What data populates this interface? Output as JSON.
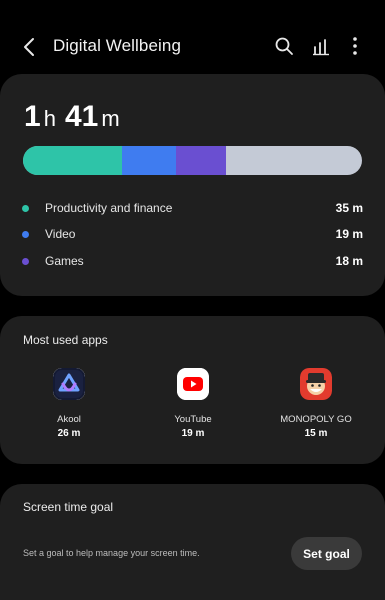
{
  "header": {
    "title": "Digital Wellbeing",
    "back_icon": "back-arrow-icon",
    "actions": [
      "search-icon",
      "stats-icon",
      "more-options-icon"
    ]
  },
  "usage": {
    "hours": "1",
    "hours_unit": "h",
    "minutes": "41",
    "minutes_unit": "m",
    "track_color": "#c4cad6",
    "categories": [
      {
        "label": "Productivity and finance",
        "value": "35 m",
        "minutes": 35,
        "color": "#2ec4a8"
      },
      {
        "label": "Video",
        "value": "19 m",
        "minutes": 19,
        "color": "#3f7cf0"
      },
      {
        "label": "Games",
        "value": "18 m",
        "minutes": 18,
        "color": "#6a4fd1"
      }
    ]
  },
  "most_used": {
    "title": "Most used apps",
    "apps": [
      {
        "name": "Akool",
        "time": "26 m",
        "icon": "akool-app-icon"
      },
      {
        "name": "YouTube",
        "time": "19 m",
        "icon": "youtube-app-icon"
      },
      {
        "name": "MONOPOLY GO",
        "time": "15 m",
        "icon": "monopoly-go-app-icon"
      }
    ]
  },
  "goal": {
    "title": "Screen time goal",
    "description": "Set a goal to help manage your screen time.",
    "button_label": "Set goal"
  }
}
